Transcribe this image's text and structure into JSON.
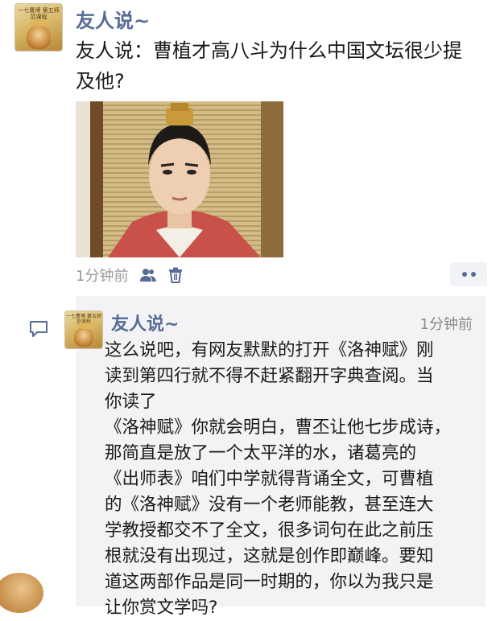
{
  "post": {
    "author": "友人说~",
    "avatar_text": "一七曹博 第五师范课程",
    "text": "友人说：曹植才高八斗为什么中国文坛很少提及他?",
    "time": "1分钟前"
  },
  "comment": {
    "author": "友人说~",
    "time": "1分钟前",
    "lines": [
      "这么说吧，有网友默默的打开《洛神赋》刚",
      "读到第四行就不得不赶紧翻开字典查阅。当",
      "你读了",
      "《洛神赋》你就会明白，曹丕让他七步成诗，",
      "那简直是放了一个太平洋的水，诸葛亮的",
      "《出师表》咱们中学就得背诵全文，可曹植",
      "的《洛神赋》没有一个老师能教，甚至连大",
      "学教授都交不了全文，很多词句在此之前压",
      "根就没有出现过，这就是创作即巅峰。要知",
      "道这两部作品是同一时期的，你以为我只是",
      "让你赏文学吗?"
    ]
  },
  "icons": [
    "privacy-friends-icon",
    "delete-icon",
    "more-icon",
    "comment-icon"
  ],
  "colors": {
    "name": "#576b95",
    "text": "#1a1a1a",
    "time": "#9a9a9a",
    "comment_bg": "#f3f3f5"
  }
}
